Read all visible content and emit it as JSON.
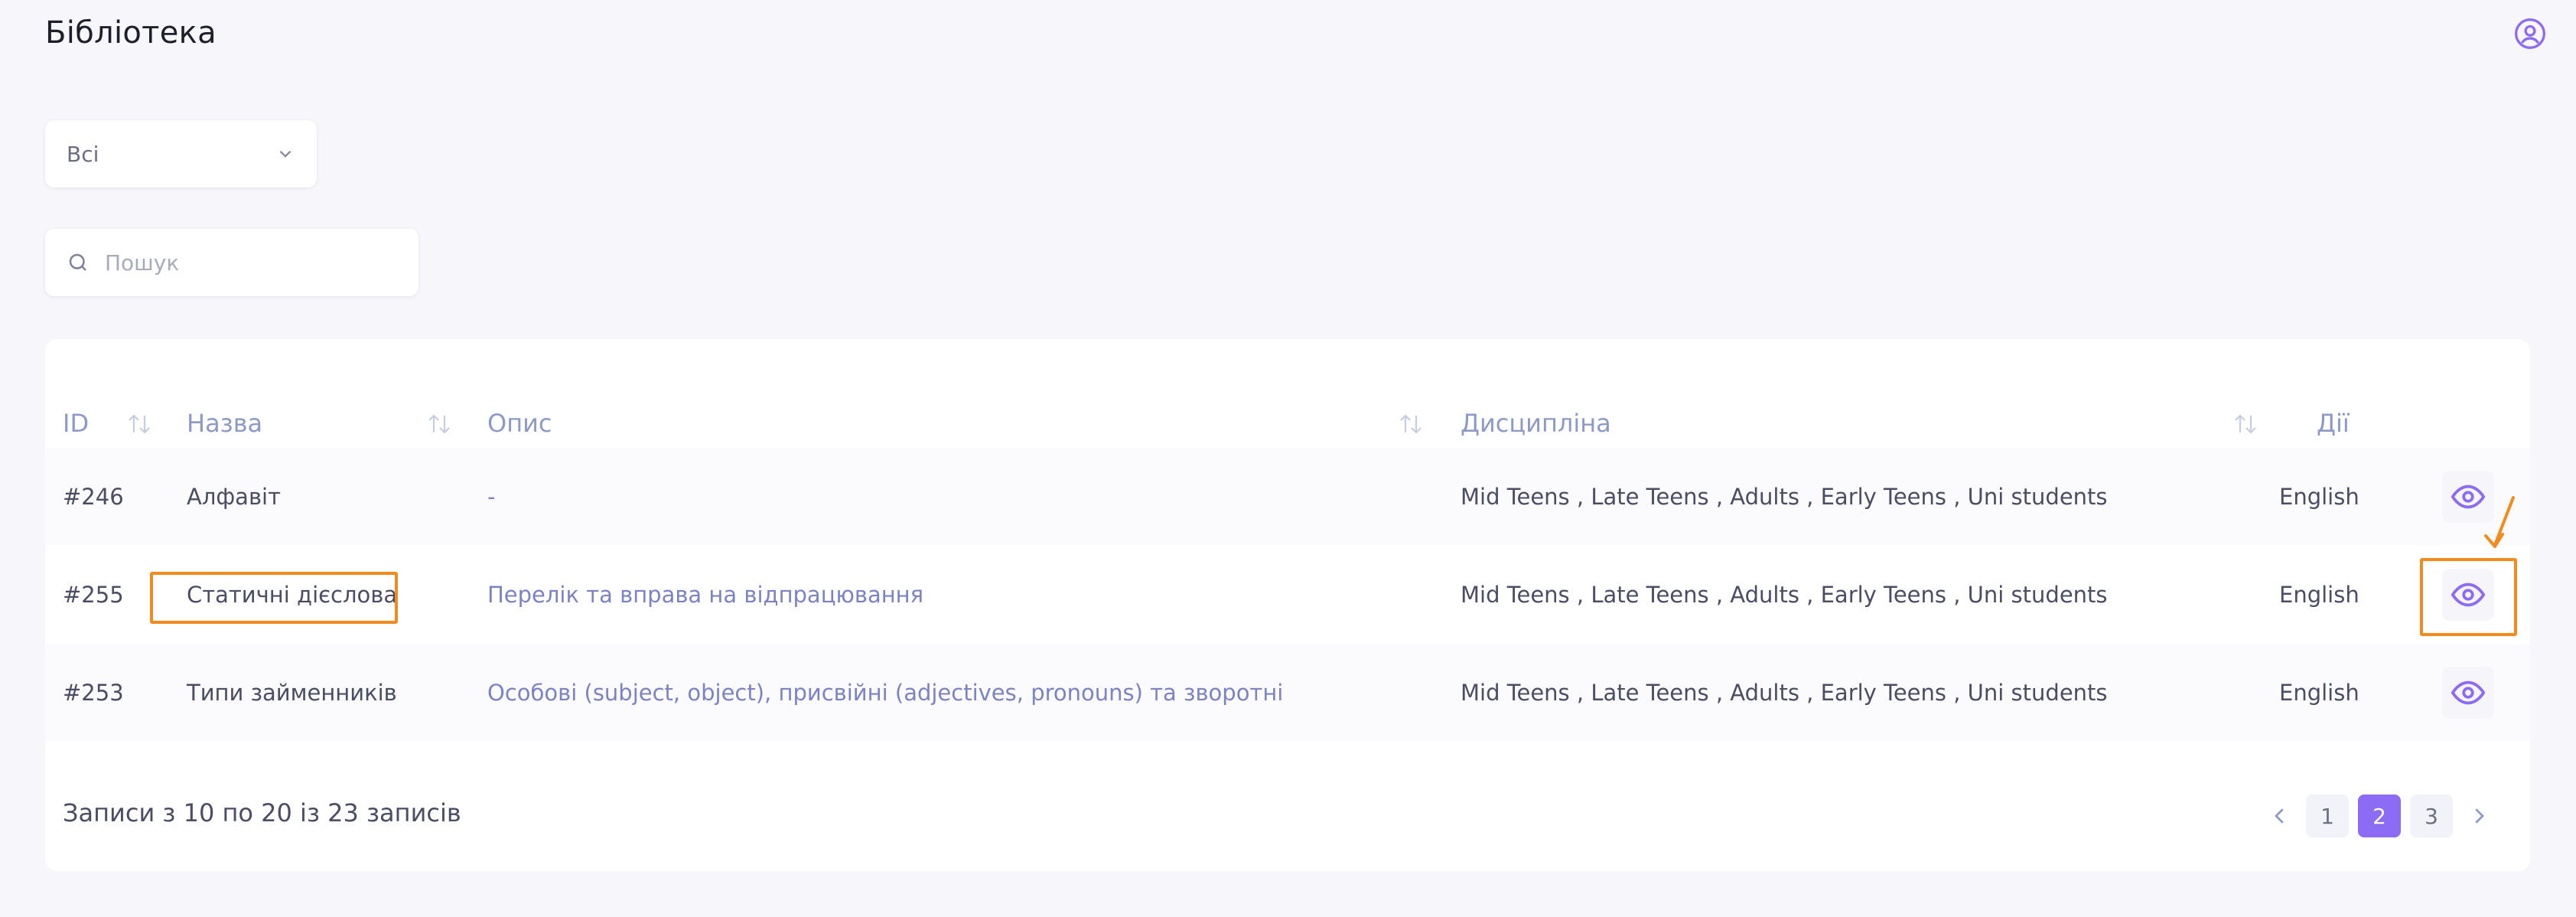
{
  "header": {
    "title": "Бібліотека",
    "user_icon": "user-circle-icon"
  },
  "filter": {
    "selected": "Всі"
  },
  "search": {
    "placeholder": "Пошук",
    "value": ""
  },
  "table": {
    "columns": {
      "id": "ID",
      "name": "Назва",
      "description": "Опис",
      "discipline": "Дисципліна",
      "actions": "Дії"
    },
    "rows": [
      {
        "id": "#246",
        "name": "Алфавіт",
        "description": "-",
        "audience": "Mid Teens , Late Teens , Adults , Early Teens , Uni students",
        "discipline": "English"
      },
      {
        "id": "#255",
        "name": "Статичні дієслова",
        "description": "Перелік та вправа на відпрацювання",
        "audience": "Mid Teens , Late Teens , Adults , Early Teens , Uni students",
        "discipline": "English"
      },
      {
        "id": "#253",
        "name": "Типи займенників",
        "description": "Особові (subject, object), присвійні (adjectives, pronouns) та зворотні",
        "audience": "Mid Teens , Late Teens , Adults , Early Teens , Uni students",
        "discipline": "English"
      }
    ]
  },
  "footer": {
    "records_info": "Записи з 10 по 20 із 23 записів"
  },
  "pagination": {
    "pages": [
      "1",
      "2",
      "3"
    ],
    "current": "2"
  },
  "colors": {
    "accent": "#8c6bf5",
    "annotation": "#f28b1e",
    "header_text": "#8e9ac6",
    "description_text": "#7b83c4"
  }
}
